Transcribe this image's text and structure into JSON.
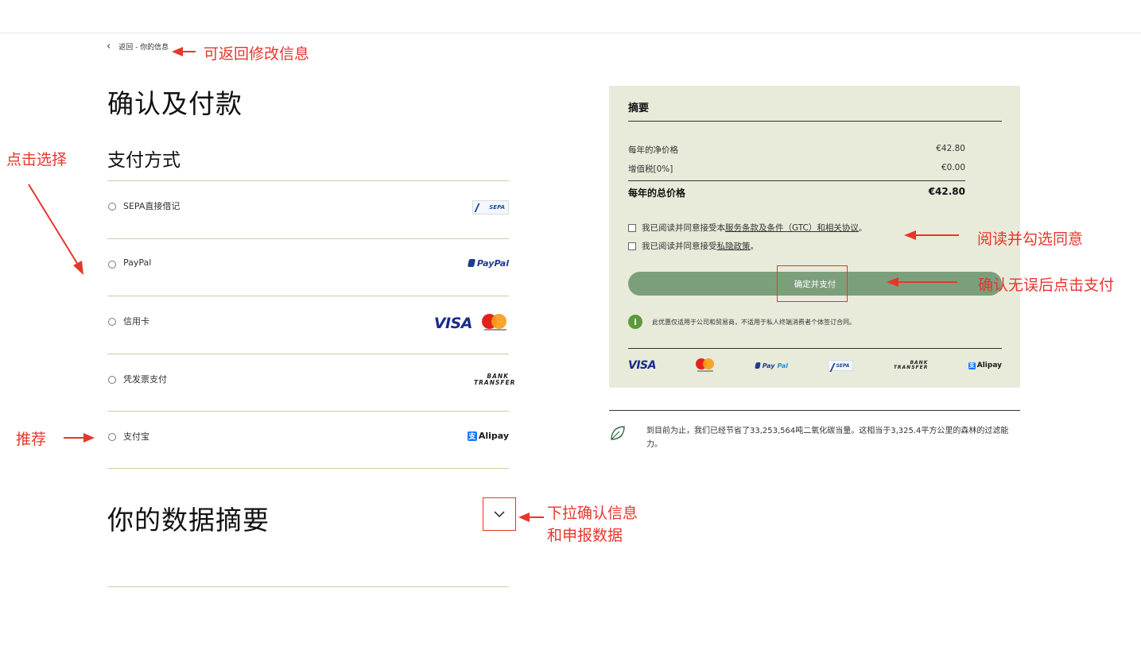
{
  "nav": {
    "back_label": "返回 - 你的信息"
  },
  "page_title": "确认及付款",
  "payment": {
    "section_title": "支付方式",
    "methods": [
      {
        "label": "SEPA直接借记",
        "logo": "SEPA"
      },
      {
        "label": "PayPal",
        "logo": "PayPal"
      },
      {
        "label": "信用卡",
        "logo": "VISA"
      },
      {
        "label": "凭发票支付",
        "logo": "BANK TRANSFER"
      },
      {
        "label": "支付宝",
        "logo": "Alipay"
      }
    ]
  },
  "data_summary": {
    "title": "你的数据摘要"
  },
  "summary": {
    "title": "摘要",
    "net_label": "每年的净价格",
    "net_value": "€42.80",
    "vat_label": "增值税[0%]",
    "vat_value": "€0.00",
    "total_label": "每年的总价格",
    "total_value": "€42.80",
    "terms_prefix": "我已阅读并同意接受本",
    "terms_link": "服务条款及条件（GTC）和相关协议",
    "terms_suffix": "。",
    "privacy_prefix": "我已阅读并同意接受",
    "privacy_link": "私隐政策",
    "privacy_suffix": "。",
    "pay_button": "确定并支付",
    "info_text": "此优惠仅适用于公司和贸易商，不适用于私人终端消费者个体签订合同。",
    "logos": {
      "visa": "VISA",
      "paypal_p": "Pay",
      "paypal_pal": "Pal",
      "sepa": "SEPA",
      "bank": "BANK",
      "transfer": "TRANSFER",
      "alipay": "Alipay"
    }
  },
  "carbon": {
    "text": "到目前为止，我们已经节省了33,253,564吨二氧化碳当量。这相当于3,325.4平方公里的森林的过滤能力。"
  },
  "annotations": {
    "back": "可返回修改信息",
    "select": "点击选择",
    "recommend": "推荐",
    "agree": "阅读并勾选同意",
    "confirm_pay": "确认无误后点击支付",
    "expand_line1": "下拉确认信息",
    "expand_line2": "和申报数据"
  },
  "colors": {
    "summary_bg": "#e8ebd9",
    "pay_button": "#7c9f7b",
    "annotation_red": "#e8352c",
    "divider": "#c9cfa9"
  }
}
